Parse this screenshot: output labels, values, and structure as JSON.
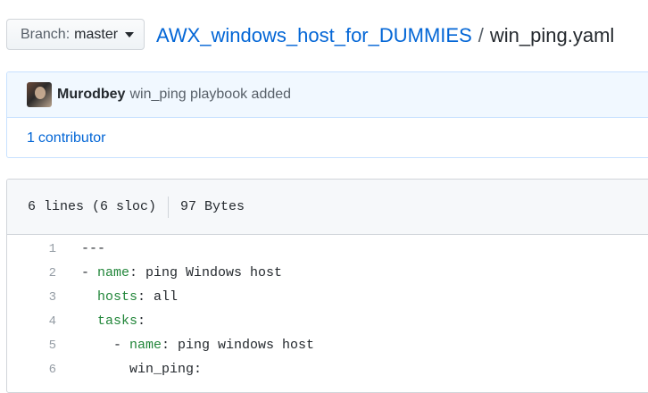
{
  "branch": {
    "label": "Branch:",
    "value": "master"
  },
  "breadcrumb": {
    "repo": "AWX_windows_host_for_DUMMIES",
    "separator": "/",
    "file": "win_ping.yaml"
  },
  "commit": {
    "author": "Murodbey",
    "message": "win_ping playbook added",
    "contributors_count": "1",
    "contributors_label": "contributor"
  },
  "file": {
    "lines_info": "6 lines (6 sloc)",
    "size": "97 Bytes",
    "code_lines": [
      {
        "n": "1",
        "indent": "",
        "key": "",
        "rest": "---"
      },
      {
        "n": "2",
        "indent": "- ",
        "key": "name",
        "rest": ": ping Windows host"
      },
      {
        "n": "3",
        "indent": "  ",
        "key": "hosts",
        "rest": ": all"
      },
      {
        "n": "4",
        "indent": "  ",
        "key": "tasks",
        "rest": ":"
      },
      {
        "n": "5",
        "indent": "    - ",
        "key": "name",
        "rest": ": ping windows host"
      },
      {
        "n": "6",
        "indent": "      ",
        "key": "",
        "rest": "win_ping:"
      }
    ]
  }
}
